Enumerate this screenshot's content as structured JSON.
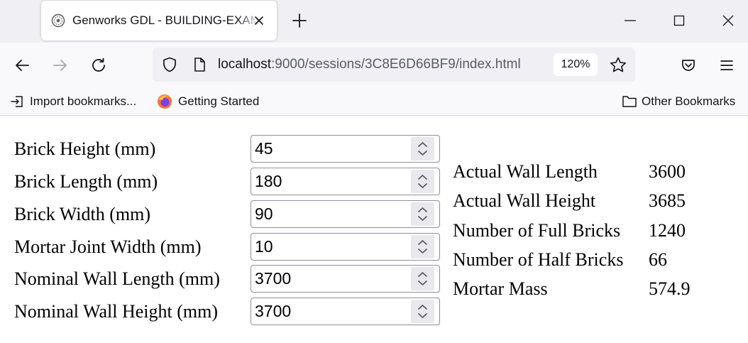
{
  "browser": {
    "tab": {
      "title": "Genworks GDL - BUILDING-EXAMPLE-ASSEMBLY"
    },
    "address": {
      "host": "localhost",
      "rest": ":9000/sessions/3C8E6D66BF9/index.html",
      "zoom": "120%"
    },
    "bookmarks": {
      "import": "Import bookmarks...",
      "getting_started": "Getting Started",
      "other": "Other Bookmarks"
    }
  },
  "form": {
    "fields": [
      {
        "label": "Brick Height (mm)",
        "value": "45"
      },
      {
        "label": "Brick Length (mm)",
        "value": "180"
      },
      {
        "label": "Brick Width (mm)",
        "value": "90"
      },
      {
        "label": "Mortar Joint Width (mm)",
        "value": "10"
      },
      {
        "label": "Nominal Wall Length (mm)",
        "value": "3700"
      },
      {
        "label": "Nominal Wall Height (mm)",
        "value": "3700"
      }
    ]
  },
  "results": [
    {
      "label": "Actual Wall Length",
      "value": "3600"
    },
    {
      "label": "Actual Wall Height",
      "value": "3685"
    },
    {
      "label": "Number of Full Bricks",
      "value": "1240"
    },
    {
      "label": "Number of Half Bricks",
      "value": "66"
    },
    {
      "label": "Mortar Mass",
      "value": "574.9"
    }
  ],
  "colors": {
    "chrome_bg": "#f0f0f4",
    "toolbar_bg": "#f9f9fb",
    "text": "#15141a",
    "muted": "#5b5b66"
  }
}
